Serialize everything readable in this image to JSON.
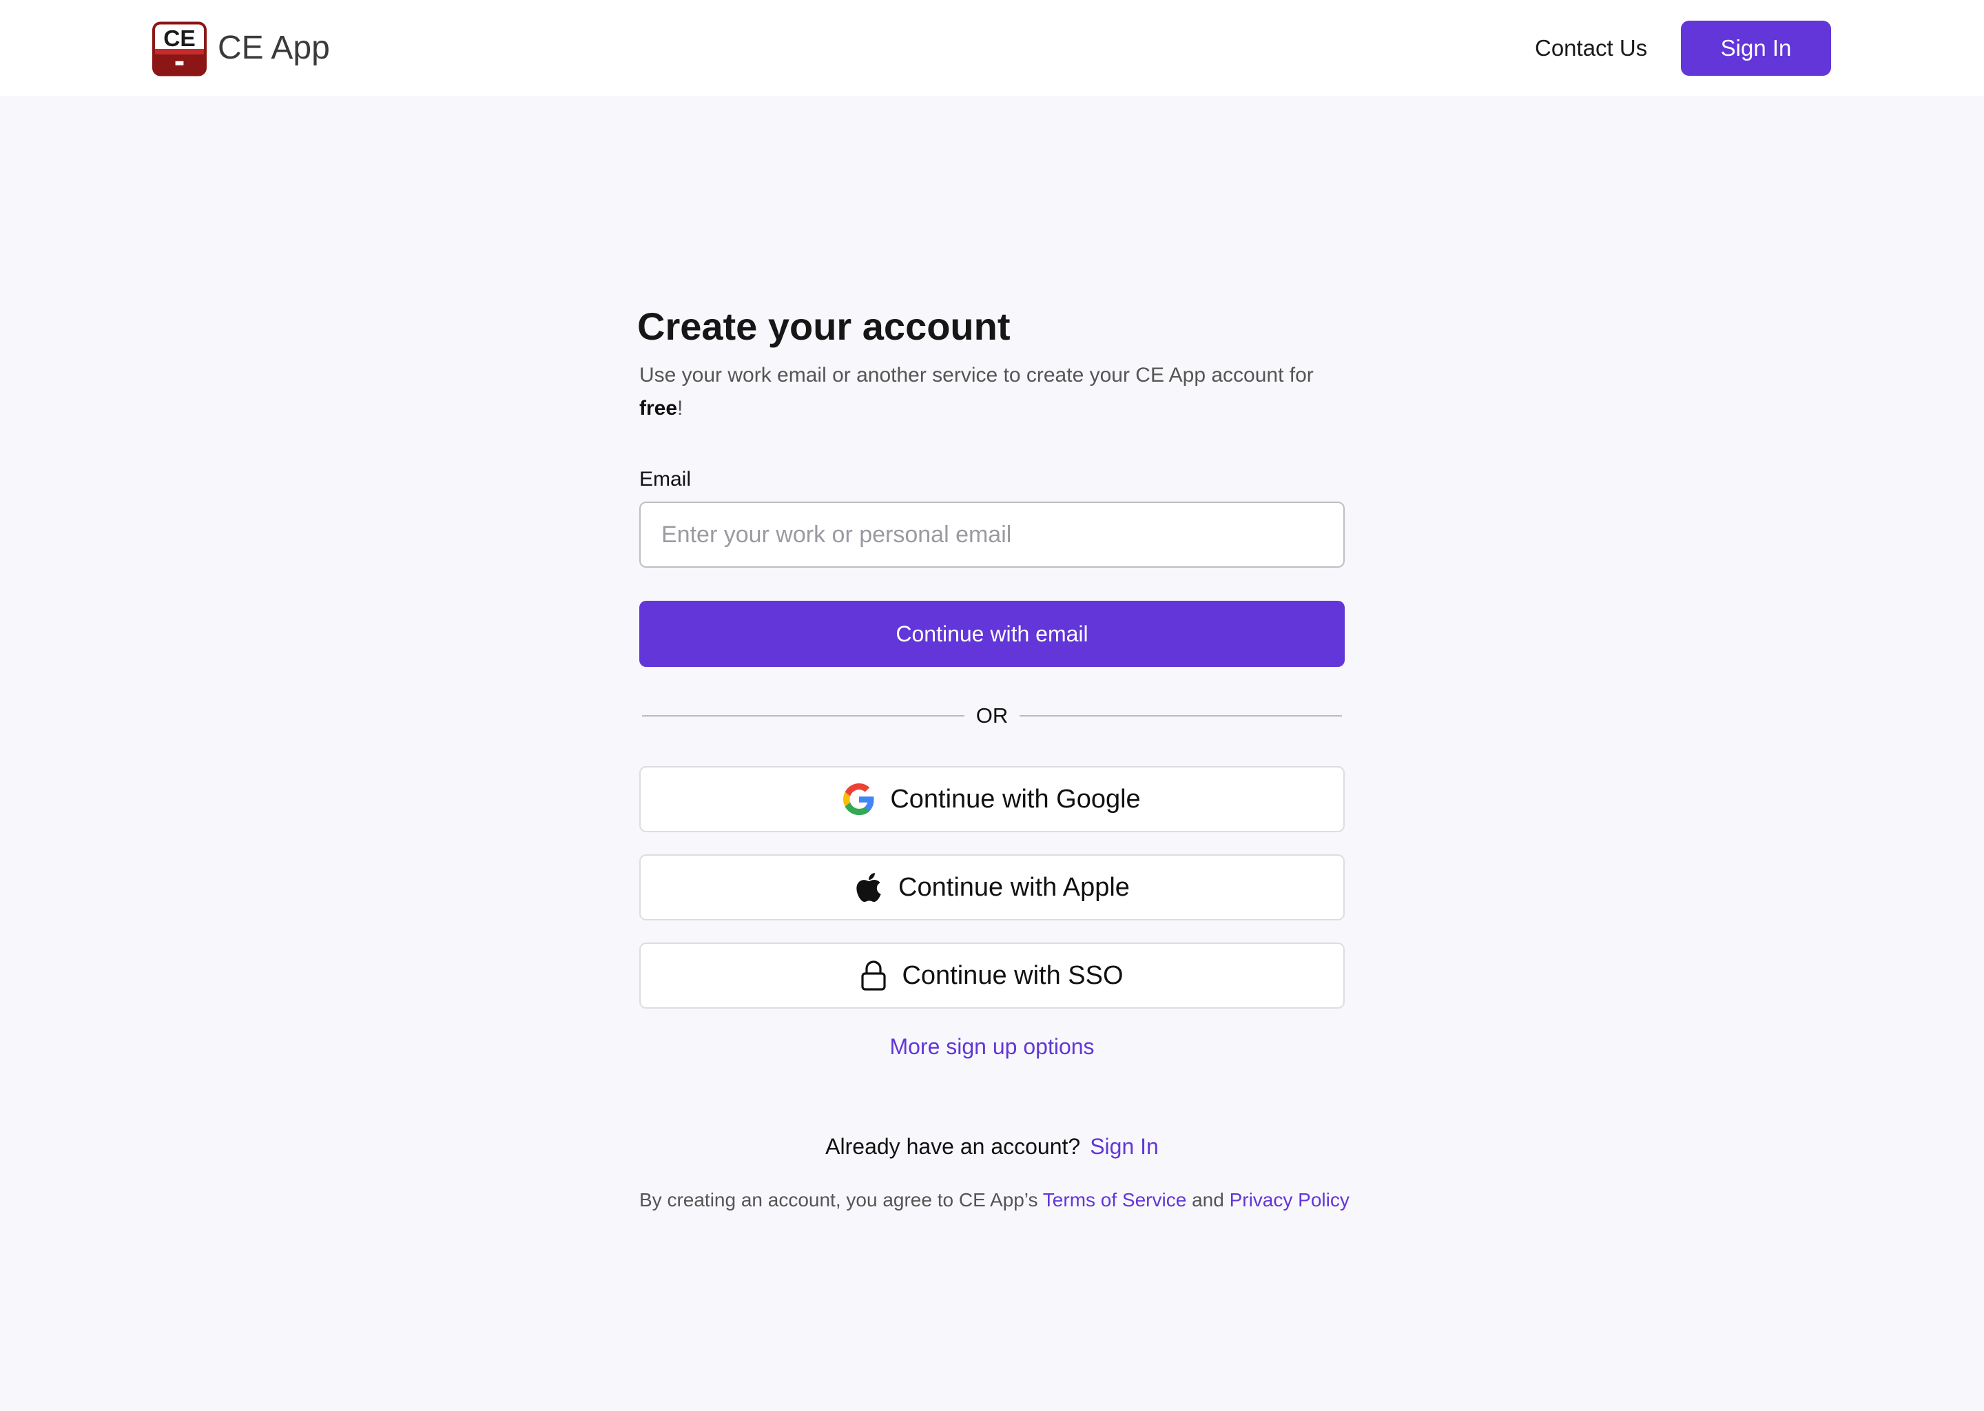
{
  "header": {
    "logo_text": "CE",
    "app_name": "CE App",
    "contact_label": "Contact Us",
    "signin_label": "Sign In"
  },
  "form": {
    "title": "Create your account",
    "subtitle_prefix": "Use your work email or another service to create your CE App account for ",
    "subtitle_bold": "free",
    "subtitle_suffix": "!",
    "email_label": "Email",
    "email_placeholder": "Enter your work or personal email",
    "email_value": "",
    "continue_email_label": "Continue with email",
    "divider_text": "OR",
    "providers": [
      {
        "label": "Continue with Google",
        "icon": "google-icon"
      },
      {
        "label": "Continue with Apple",
        "icon": "apple-icon"
      },
      {
        "label": "Continue with SSO",
        "icon": "lock-icon"
      }
    ],
    "more_options_label": "More sign up options"
  },
  "footer": {
    "already_text": "Already have an account?",
    "signin_link": "Sign In",
    "legal_prefix": "By creating an account, you agree to CE App’s ",
    "terms_label": "Terms of Service",
    "legal_and": " and ",
    "privacy_label": "Privacy Policy"
  },
  "colors": {
    "accent": "#6236d8",
    "background": "#f8f8fc",
    "logo_red": "#9b1b1b"
  }
}
